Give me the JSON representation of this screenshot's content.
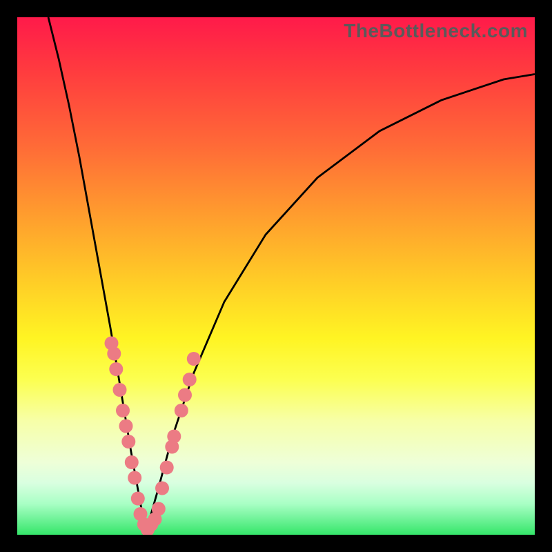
{
  "watermark_text": "TheBottleneck.com",
  "colors": {
    "dot": "#ec7b84",
    "curve": "#000000",
    "gradient_top": "#ff1a4a",
    "gradient_bottom": "#35e66a"
  },
  "chart_data": {
    "type": "line",
    "title": "",
    "xlabel": "",
    "ylabel": "",
    "xlim": [
      0,
      100
    ],
    "ylim": [
      0,
      100
    ],
    "grid": false,
    "curves": {
      "description": "Two convex curves meeting at a cusp near x≈25; left branch falls from top-left to the minimum, right branch rises toward upper-right.",
      "minimum_at_x": 25,
      "left_branch": [
        {
          "x": 6,
          "y": 100
        },
        {
          "x": 8,
          "y": 92
        },
        {
          "x": 10,
          "y": 83
        },
        {
          "x": 12,
          "y": 73
        },
        {
          "x": 14,
          "y": 62
        },
        {
          "x": 16,
          "y": 51
        },
        {
          "x": 18,
          "y": 40
        },
        {
          "x": 20,
          "y": 28
        },
        {
          "x": 22,
          "y": 16
        },
        {
          "x": 24,
          "y": 5
        },
        {
          "x": 25,
          "y": 1
        }
      ],
      "right_branch": [
        {
          "x": 25,
          "y": 1
        },
        {
          "x": 27,
          "y": 8
        },
        {
          "x": 30,
          "y": 19
        },
        {
          "x": 34,
          "y": 31
        },
        {
          "x": 40,
          "y": 45
        },
        {
          "x": 48,
          "y": 58
        },
        {
          "x": 58,
          "y": 69
        },
        {
          "x": 70,
          "y": 78
        },
        {
          "x": 82,
          "y": 84
        },
        {
          "x": 94,
          "y": 88
        },
        {
          "x": 100,
          "y": 89
        }
      ]
    },
    "dot_clusters": [
      {
        "branch": "left",
        "x_range": [
          18,
          24
        ],
        "y_range": [
          5,
          37
        ],
        "count": 10
      },
      {
        "branch": "trough",
        "x_range": [
          24,
          27
        ],
        "y_range": [
          1,
          5
        ],
        "count": 6
      },
      {
        "branch": "right",
        "x_range": [
          27,
          34
        ],
        "y_range": [
          8,
          34
        ],
        "count": 8
      }
    ],
    "dots": [
      {
        "x": 18.2,
        "y": 37
      },
      {
        "x": 18.7,
        "y": 35
      },
      {
        "x": 19.1,
        "y": 32
      },
      {
        "x": 19.8,
        "y": 28
      },
      {
        "x": 20.4,
        "y": 24
      },
      {
        "x": 21.0,
        "y": 21
      },
      {
        "x": 21.5,
        "y": 18
      },
      {
        "x": 22.1,
        "y": 14
      },
      {
        "x": 22.7,
        "y": 11
      },
      {
        "x": 23.3,
        "y": 7
      },
      {
        "x": 23.8,
        "y": 4
      },
      {
        "x": 24.5,
        "y": 2
      },
      {
        "x": 25.2,
        "y": 1
      },
      {
        "x": 25.9,
        "y": 2
      },
      {
        "x": 26.6,
        "y": 3
      },
      {
        "x": 27.3,
        "y": 5
      },
      {
        "x": 28.0,
        "y": 9
      },
      {
        "x": 28.9,
        "y": 13
      },
      {
        "x": 29.9,
        "y": 17
      },
      {
        "x": 30.3,
        "y": 19
      },
      {
        "x": 31.7,
        "y": 24
      },
      {
        "x": 32.4,
        "y": 27
      },
      {
        "x": 33.3,
        "y": 30
      },
      {
        "x": 34.1,
        "y": 34
      }
    ]
  }
}
